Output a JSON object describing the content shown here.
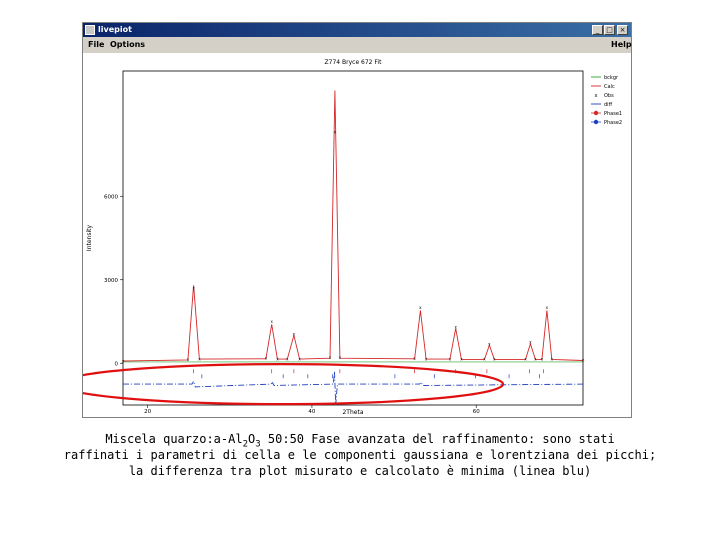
{
  "window": {
    "title": "livepiot",
    "buttons": [
      "_",
      "□",
      "×"
    ],
    "menu": {
      "file": "File",
      "options": "Options",
      "help": "Help"
    }
  },
  "chart_data": {
    "type": "line",
    "title": "Z774 Bryce 672 Fit",
    "xlabel": "2Theta",
    "ylabel": "Intensity",
    "xlim": [
      17,
      73
    ],
    "ylim": [
      -1500,
      10500
    ],
    "x_ticks": [
      20,
      40,
      60
    ],
    "x_tick_labels": [
      "20",
      "40",
      "60"
    ],
    "y_ticks": [
      0,
      3000,
      6000
    ],
    "y_tick_labels": [
      "0",
      "3000",
      "6000"
    ],
    "series": [
      {
        "name": "bckgr",
        "color": "#2ca02c",
        "values": [
          [
            17,
            50
          ],
          [
            73,
            50
          ]
        ]
      },
      {
        "name": "Calc",
        "color": "#d62728",
        "values": [
          [
            17,
            80
          ],
          [
            24.9,
            120
          ],
          [
            25.6,
            2800
          ],
          [
            26.3,
            150
          ],
          [
            34.4,
            160
          ],
          [
            35.1,
            1400
          ],
          [
            35.8,
            150
          ],
          [
            37.0,
            150
          ],
          [
            37.8,
            1000
          ],
          [
            38.5,
            150
          ],
          [
            42.2,
            180
          ],
          [
            42.8,
            9800
          ],
          [
            43.4,
            180
          ],
          [
            52.5,
            160
          ],
          [
            53.2,
            1900
          ],
          [
            53.9,
            150
          ],
          [
            56.8,
            150
          ],
          [
            57.5,
            1250
          ],
          [
            58.2,
            140
          ],
          [
            61.0,
            140
          ],
          [
            61.6,
            650
          ],
          [
            62.2,
            140
          ],
          [
            66.0,
            140
          ],
          [
            66.6,
            700
          ],
          [
            67.2,
            140
          ],
          [
            68.0,
            140
          ],
          [
            68.6,
            1900
          ],
          [
            69.2,
            140
          ],
          [
            73,
            100
          ]
        ]
      },
      {
        "name": "Obs",
        "color": "#000000",
        "values": [
          [
            17,
            80
          ],
          [
            24.9,
            140
          ],
          [
            25.6,
            2700
          ],
          [
            26.3,
            160
          ],
          [
            34.4,
            180
          ],
          [
            35.1,
            1500
          ],
          [
            35.8,
            160
          ],
          [
            37.0,
            160
          ],
          [
            37.8,
            1050
          ],
          [
            38.5,
            160
          ],
          [
            42.2,
            200
          ],
          [
            42.8,
            8300
          ],
          [
            43.4,
            200
          ],
          [
            52.5,
            170
          ],
          [
            53.2,
            2000
          ],
          [
            53.9,
            160
          ],
          [
            56.8,
            160
          ],
          [
            57.5,
            1300
          ],
          [
            58.2,
            150
          ],
          [
            61.0,
            150
          ],
          [
            61.6,
            700
          ],
          [
            62.2,
            150
          ],
          [
            66.0,
            150
          ],
          [
            66.6,
            760
          ],
          [
            67.2,
            150
          ],
          [
            68.0,
            150
          ],
          [
            68.6,
            2000
          ],
          [
            69.2,
            150
          ],
          [
            73,
            110
          ]
        ]
      },
      {
        "name": "diff",
        "color": "#1f3fbf",
        "values": [
          [
            17,
            -750
          ],
          [
            25.4,
            -750
          ],
          [
            25.6,
            -650
          ],
          [
            25.8,
            -850
          ],
          [
            35.0,
            -750
          ],
          [
            35.2,
            -700
          ],
          [
            35.4,
            -800
          ],
          [
            42.6,
            -750
          ],
          [
            42.75,
            -300
          ],
          [
            42.9,
            -1500
          ],
          [
            43.1,
            -750
          ],
          [
            53.1,
            -750
          ],
          [
            53.3,
            -680
          ],
          [
            53.5,
            -800
          ],
          [
            73,
            -750
          ]
        ]
      },
      {
        "name": "Phase1",
        "color": "#d62728",
        "ticks": [
          25.6,
          35.1,
          37.8,
          43.4,
          52.5,
          57.5,
          61.3,
          66.5,
          68.2
        ]
      },
      {
        "name": "Phase2",
        "color": "#1f3fbf",
        "ticks": [
          26.6,
          36.5,
          39.5,
          42.5,
          50.1,
          54.9,
          59.9,
          64.0,
          67.7
        ]
      }
    ],
    "legend_position": "right",
    "grid": false,
    "annotation": "red ellipse around the difference curve"
  },
  "caption": {
    "line1_pre": "Miscela quarzo:a-Al",
    "sub1": "2",
    "line1_mid": "O",
    "sub2": "3",
    "line1_post": "  50:50 Fase avanzata del raffinamento: sono stati",
    "line2": "raffinati i parametri di cella e le componenti gaussiana e lorentziana dei picchi;",
    "line3": "la differenza tra plot misurato e calcolato è minima (linea blu)"
  }
}
